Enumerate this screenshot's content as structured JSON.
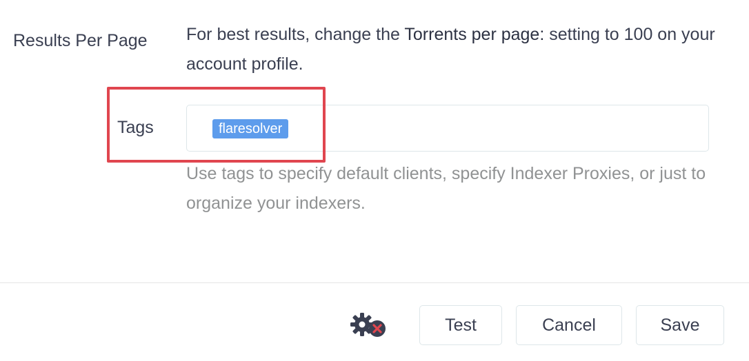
{
  "form": {
    "results_per_page": {
      "label": "Results Per Page",
      "help_prefix": "For best results, change the ",
      "help_emphasis": "Torrents per page:",
      "help_suffix": " setting to 100 on your account profile."
    },
    "tags": {
      "label": "Tags",
      "values": [
        "flaresolver"
      ],
      "help": "Use tags to specify default clients, specify Indexer Proxies, or just to organize your indexers."
    }
  },
  "footer": {
    "test_label": "Test",
    "cancel_label": "Cancel",
    "save_label": "Save"
  },
  "colors": {
    "tag_chip": "#5d9cec",
    "highlight_border": "#e0464f",
    "text": "#3a3f51",
    "muted_text": "#909293"
  },
  "icons": {
    "advanced_settings": "gear-with-red-x-icon"
  }
}
